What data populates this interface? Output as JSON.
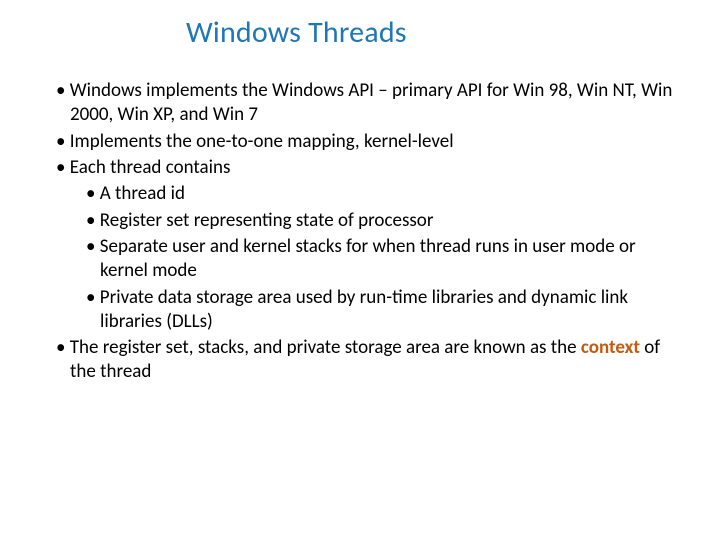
{
  "title": "Windows Threads",
  "bullets": {
    "b1": "Windows implements the Windows API – primary API for Win 98, Win NT, Win 2000, Win XP, and Win 7",
    "b2": "Implements the one-to-one mapping, kernel-level",
    "b3": "Each thread contains",
    "b3a": "A thread id",
    "b3b": "Register set representing state of processor",
    "b3c": "Separate user and kernel stacks for when thread runs in user mode or kernel mode",
    "b3d": "Private data storage area used by run-time libraries and dynamic link libraries (DLLs)",
    "b4_pre": "The register set, stacks, and private storage area are known as the ",
    "b4_hl": "context",
    "b4_post": " of the thread"
  }
}
